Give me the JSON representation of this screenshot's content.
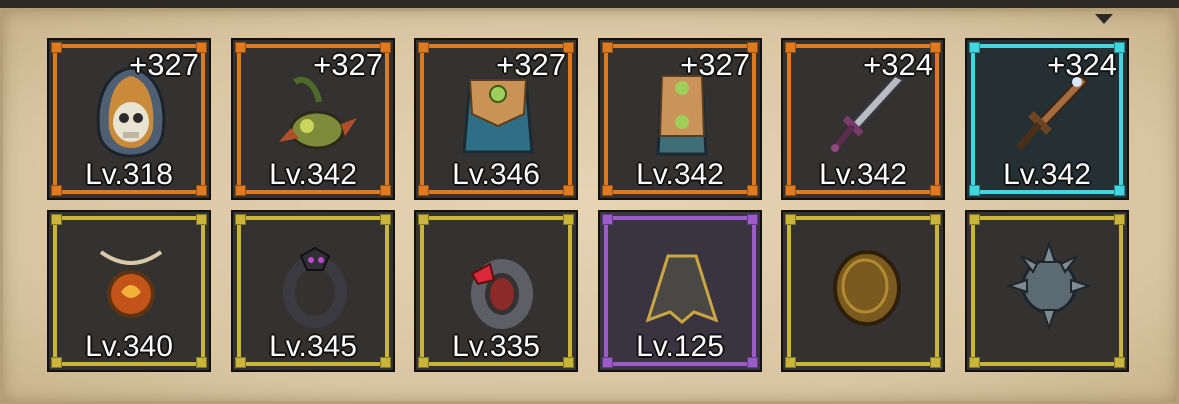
{
  "colors": {
    "orange": "#e07a1e",
    "cyan": "#3fd6de",
    "yellow": "#c9b53a",
    "purple": "#9b5cc9",
    "panel": "#dcc8a6"
  },
  "rows": [
    [
      {
        "rarity": "orange",
        "bonus": "+327",
        "level": "Lv.318",
        "icon": "hood-mask-icon"
      },
      {
        "rarity": "orange",
        "bonus": "+327",
        "level": "Lv.342",
        "icon": "bird-helmet-icon"
      },
      {
        "rarity": "orange",
        "bonus": "+327",
        "level": "Lv.346",
        "icon": "chest-armor-icon"
      },
      {
        "rarity": "orange",
        "bonus": "+327",
        "level": "Lv.342",
        "icon": "leg-armor-icon"
      },
      {
        "rarity": "orange",
        "bonus": "+324",
        "level": "Lv.342",
        "icon": "sword-icon"
      },
      {
        "rarity": "cyan",
        "bonus": "+324",
        "level": "Lv.342",
        "icon": "ornate-sword-icon"
      }
    ],
    [
      {
        "rarity": "yellow",
        "bonus": "",
        "level": "Lv.340",
        "icon": "amulet-icon"
      },
      {
        "rarity": "yellow",
        "bonus": "",
        "level": "Lv.345",
        "icon": "dark-ring-icon"
      },
      {
        "rarity": "yellow",
        "bonus": "",
        "level": "Lv.335",
        "icon": "ruby-ring-icon"
      },
      {
        "rarity": "purple",
        "bonus": "",
        "level": "Lv.125",
        "icon": "cloak-icon"
      },
      {
        "rarity": "yellow",
        "bonus": "",
        "level": "",
        "icon": "coin-talisman-icon"
      },
      {
        "rarity": "yellow",
        "bonus": "",
        "level": "",
        "icon": "spiked-orb-icon"
      }
    ]
  ]
}
